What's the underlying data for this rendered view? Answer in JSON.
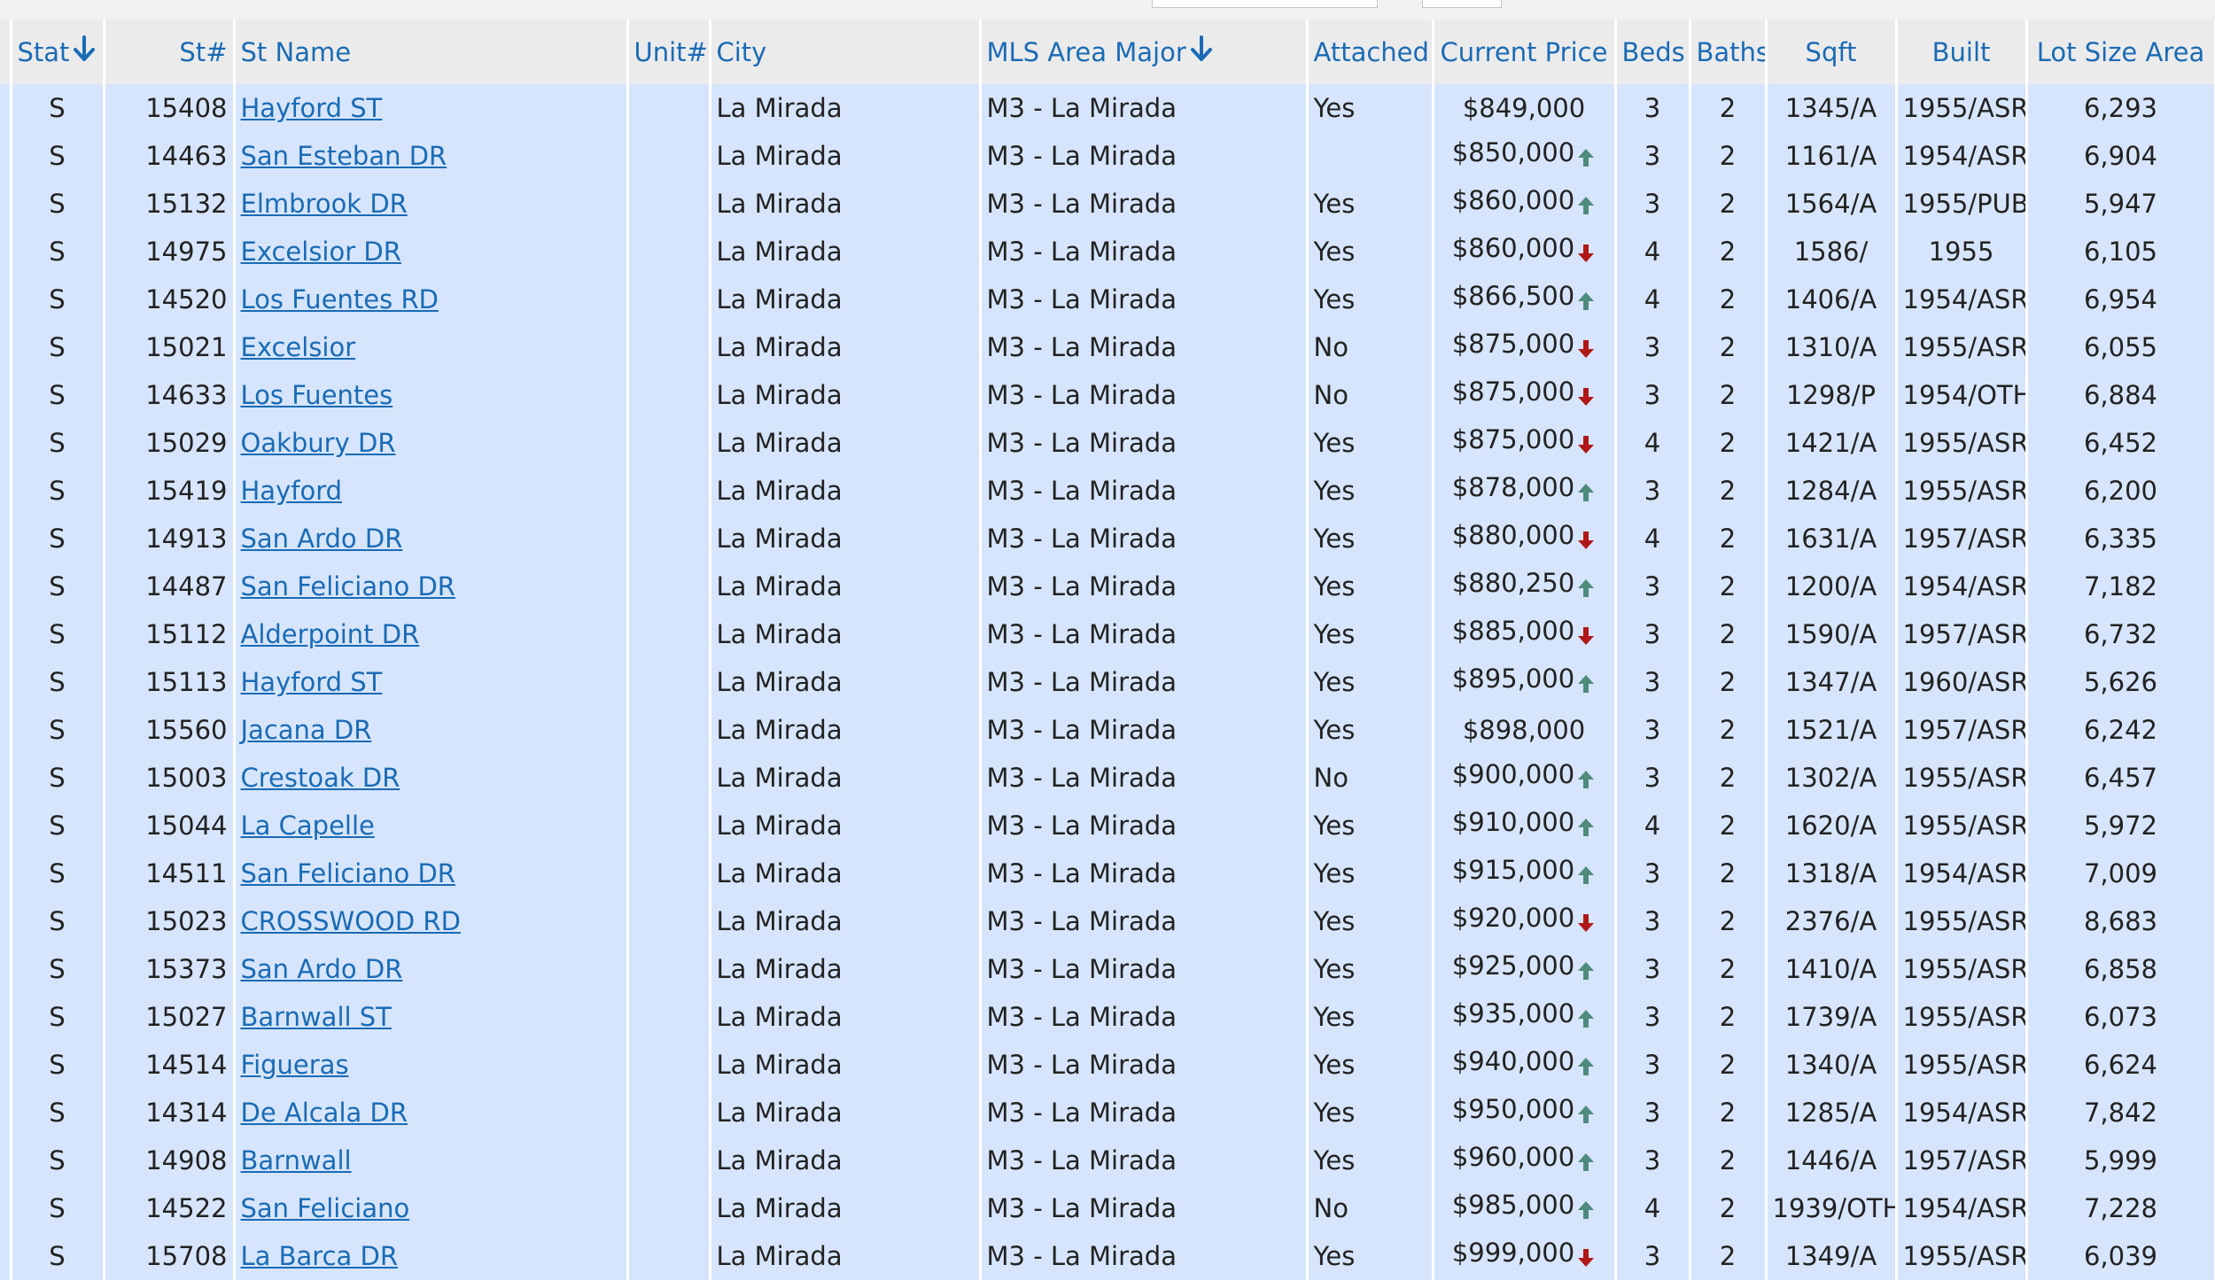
{
  "columns": {
    "stat": "Stat",
    "st_num": "St#",
    "st_name": "St Name",
    "unit": "Unit#",
    "city": "City",
    "mls_area": "MLS Area Major",
    "attached": "Attached",
    "current_price": "Current Price",
    "beds": "Beds",
    "baths": "Baths",
    "sqft": "Sqft",
    "built": "Built",
    "lot_size": "Lot Size Area"
  },
  "colors": {
    "link": "#1a6bb5",
    "row_bg": "#d6e5fb",
    "header_bg": "#ebebeb",
    "trend_up": "#4e8b7d",
    "trend_down": "#b01818"
  },
  "rows": [
    {
      "stat": "S",
      "st_num": "15408",
      "st_name": "Hayford ST",
      "unit": "",
      "city": "La Mirada",
      "mls": "M3 - La Mirada",
      "attached": "Yes",
      "price": "$849,000",
      "trend": "",
      "beds": "3",
      "baths": "2",
      "sqft": "1345/A",
      "built": "1955/ASR",
      "lot": "6,293"
    },
    {
      "stat": "S",
      "st_num": "14463",
      "st_name": "San Esteban DR",
      "unit": "",
      "city": "La Mirada",
      "mls": "M3 - La Mirada",
      "attached": "",
      "price": "$850,000",
      "trend": "up",
      "beds": "3",
      "baths": "2",
      "sqft": "1161/A",
      "built": "1954/ASR",
      "lot": "6,904"
    },
    {
      "stat": "S",
      "st_num": "15132",
      "st_name": "Elmbrook DR",
      "unit": "",
      "city": "La Mirada",
      "mls": "M3 - La Mirada",
      "attached": "Yes",
      "price": "$860,000",
      "trend": "up",
      "beds": "3",
      "baths": "2",
      "sqft": "1564/A",
      "built": "1955/PUB",
      "lot": "5,947"
    },
    {
      "stat": "S",
      "st_num": "14975",
      "st_name": "Excelsior DR",
      "unit": "",
      "city": "La Mirada",
      "mls": "M3 - La Mirada",
      "attached": "Yes",
      "price": "$860,000",
      "trend": "down",
      "beds": "4",
      "baths": "2",
      "sqft": "1586/",
      "built": "1955",
      "lot": "6,105"
    },
    {
      "stat": "S",
      "st_num": "14520",
      "st_name": "Los Fuentes RD",
      "unit": "",
      "city": "La Mirada",
      "mls": "M3 - La Mirada",
      "attached": "Yes",
      "price": "$866,500",
      "trend": "up",
      "beds": "4",
      "baths": "2",
      "sqft": "1406/A",
      "built": "1954/ASR",
      "lot": "6,954"
    },
    {
      "stat": "S",
      "st_num": "15021",
      "st_name": "Excelsior",
      "unit": "",
      "city": "La Mirada",
      "mls": "M3 - La Mirada",
      "attached": "No",
      "price": "$875,000",
      "trend": "down",
      "beds": "3",
      "baths": "2",
      "sqft": "1310/A",
      "built": "1955/ASR",
      "lot": "6,055"
    },
    {
      "stat": "S",
      "st_num": "14633",
      "st_name": "Los Fuentes",
      "unit": "",
      "city": "La Mirada",
      "mls": "M3 - La Mirada",
      "attached": "No",
      "price": "$875,000",
      "trend": "down",
      "beds": "3",
      "baths": "2",
      "sqft": "1298/P",
      "built": "1954/OTH",
      "lot": "6,884"
    },
    {
      "stat": "S",
      "st_num": "15029",
      "st_name": "Oakbury DR",
      "unit": "",
      "city": "La Mirada",
      "mls": "M3 - La Mirada",
      "attached": "Yes",
      "price": "$875,000",
      "trend": "down",
      "beds": "4",
      "baths": "2",
      "sqft": "1421/A",
      "built": "1955/ASR",
      "lot": "6,452"
    },
    {
      "stat": "S",
      "st_num": "15419",
      "st_name": "Hayford",
      "unit": "",
      "city": "La Mirada",
      "mls": "M3 - La Mirada",
      "attached": "Yes",
      "price": "$878,000",
      "trend": "up",
      "beds": "3",
      "baths": "2",
      "sqft": "1284/A",
      "built": "1955/ASR",
      "lot": "6,200"
    },
    {
      "stat": "S",
      "st_num": "14913",
      "st_name": "San Ardo DR",
      "unit": "",
      "city": "La Mirada",
      "mls": "M3 - La Mirada",
      "attached": "Yes",
      "price": "$880,000",
      "trend": "down",
      "beds": "4",
      "baths": "2",
      "sqft": "1631/A",
      "built": "1957/ASR",
      "lot": "6,335"
    },
    {
      "stat": "S",
      "st_num": "14487",
      "st_name": "San Feliciano DR",
      "unit": "",
      "city": "La Mirada",
      "mls": "M3 - La Mirada",
      "attached": "Yes",
      "price": "$880,250",
      "trend": "up",
      "beds": "3",
      "baths": "2",
      "sqft": "1200/A",
      "built": "1954/ASR",
      "lot": "7,182"
    },
    {
      "stat": "S",
      "st_num": "15112",
      "st_name": "Alderpoint DR",
      "unit": "",
      "city": "La Mirada",
      "mls": "M3 - La Mirada",
      "attached": "Yes",
      "price": "$885,000",
      "trend": "down",
      "beds": "3",
      "baths": "2",
      "sqft": "1590/A",
      "built": "1957/ASR",
      "lot": "6,732"
    },
    {
      "stat": "S",
      "st_num": "15113",
      "st_name": "Hayford ST",
      "unit": "",
      "city": "La Mirada",
      "mls": "M3 - La Mirada",
      "attached": "Yes",
      "price": "$895,000",
      "trend": "up",
      "beds": "3",
      "baths": "2",
      "sqft": "1347/A",
      "built": "1960/ASR",
      "lot": "5,626"
    },
    {
      "stat": "S",
      "st_num": "15560",
      "st_name": "Jacana DR",
      "unit": "",
      "city": "La Mirada",
      "mls": "M3 - La Mirada",
      "attached": "Yes",
      "price": "$898,000",
      "trend": "",
      "beds": "3",
      "baths": "2",
      "sqft": "1521/A",
      "built": "1957/ASR",
      "lot": "6,242"
    },
    {
      "stat": "S",
      "st_num": "15003",
      "st_name": "Crestoak DR",
      "unit": "",
      "city": "La Mirada",
      "mls": "M3 - La Mirada",
      "attached": "No",
      "price": "$900,000",
      "trend": "up",
      "beds": "3",
      "baths": "2",
      "sqft": "1302/A",
      "built": "1955/ASR",
      "lot": "6,457"
    },
    {
      "stat": "S",
      "st_num": "15044",
      "st_name": "La Capelle",
      "unit": "",
      "city": "La Mirada",
      "mls": "M3 - La Mirada",
      "attached": "Yes",
      "price": "$910,000",
      "trend": "up",
      "beds": "4",
      "baths": "2",
      "sqft": "1620/A",
      "built": "1955/ASR",
      "lot": "5,972"
    },
    {
      "stat": "S",
      "st_num": "14511",
      "st_name": "San Feliciano DR",
      "unit": "",
      "city": "La Mirada",
      "mls": "M3 - La Mirada",
      "attached": "Yes",
      "price": "$915,000",
      "trend": "up",
      "beds": "3",
      "baths": "2",
      "sqft": "1318/A",
      "built": "1954/ASR",
      "lot": "7,009"
    },
    {
      "stat": "S",
      "st_num": "15023",
      "st_name": "CROSSWOOD RD",
      "unit": "",
      "city": "La Mirada",
      "mls": "M3 - La Mirada",
      "attached": "Yes",
      "price": "$920,000",
      "trend": "down",
      "beds": "3",
      "baths": "2",
      "sqft": "2376/A",
      "built": "1955/ASR",
      "lot": "8,683"
    },
    {
      "stat": "S",
      "st_num": "15373",
      "st_name": "San Ardo DR",
      "unit": "",
      "city": "La Mirada",
      "mls": "M3 - La Mirada",
      "attached": "Yes",
      "price": "$925,000",
      "trend": "up",
      "beds": "3",
      "baths": "2",
      "sqft": "1410/A",
      "built": "1955/ASR",
      "lot": "6,858"
    },
    {
      "stat": "S",
      "st_num": "15027",
      "st_name": "Barnwall ST",
      "unit": "",
      "city": "La Mirada",
      "mls": "M3 - La Mirada",
      "attached": "Yes",
      "price": "$935,000",
      "trend": "up",
      "beds": "3",
      "baths": "2",
      "sqft": "1739/A",
      "built": "1955/ASR",
      "lot": "6,073"
    },
    {
      "stat": "S",
      "st_num": "14514",
      "st_name": "Figueras",
      "unit": "",
      "city": "La Mirada",
      "mls": "M3 - La Mirada",
      "attached": "Yes",
      "price": "$940,000",
      "trend": "up",
      "beds": "3",
      "baths": "2",
      "sqft": "1340/A",
      "built": "1955/ASR",
      "lot": "6,624"
    },
    {
      "stat": "S",
      "st_num": "14314",
      "st_name": "De Alcala DR",
      "unit": "",
      "city": "La Mirada",
      "mls": "M3 - La Mirada",
      "attached": "Yes",
      "price": "$950,000",
      "trend": "up",
      "beds": "3",
      "baths": "2",
      "sqft": "1285/A",
      "built": "1954/ASR",
      "lot": "7,842"
    },
    {
      "stat": "S",
      "st_num": "14908",
      "st_name": "Barnwall",
      "unit": "",
      "city": "La Mirada",
      "mls": "M3 - La Mirada",
      "attached": "Yes",
      "price": "$960,000",
      "trend": "up",
      "beds": "3",
      "baths": "2",
      "sqft": "1446/A",
      "built": "1957/ASR",
      "lot": "5,999"
    },
    {
      "stat": "S",
      "st_num": "14522",
      "st_name": "San Feliciano",
      "unit": "",
      "city": "La Mirada",
      "mls": "M3 - La Mirada",
      "attached": "No",
      "price": "$985,000",
      "trend": "up",
      "beds": "4",
      "baths": "2",
      "sqft": "1939/OTH",
      "built": "1954/ASR",
      "lot": "7,228"
    },
    {
      "stat": "S",
      "st_num": "15708",
      "st_name": "La Barca DR",
      "unit": "",
      "city": "La Mirada",
      "mls": "M3 - La Mirada",
      "attached": "Yes",
      "price": "$999,000",
      "trend": "down",
      "beds": "3",
      "baths": "2",
      "sqft": "1349/A",
      "built": "1955/ASR",
      "lot": "6,039"
    }
  ]
}
